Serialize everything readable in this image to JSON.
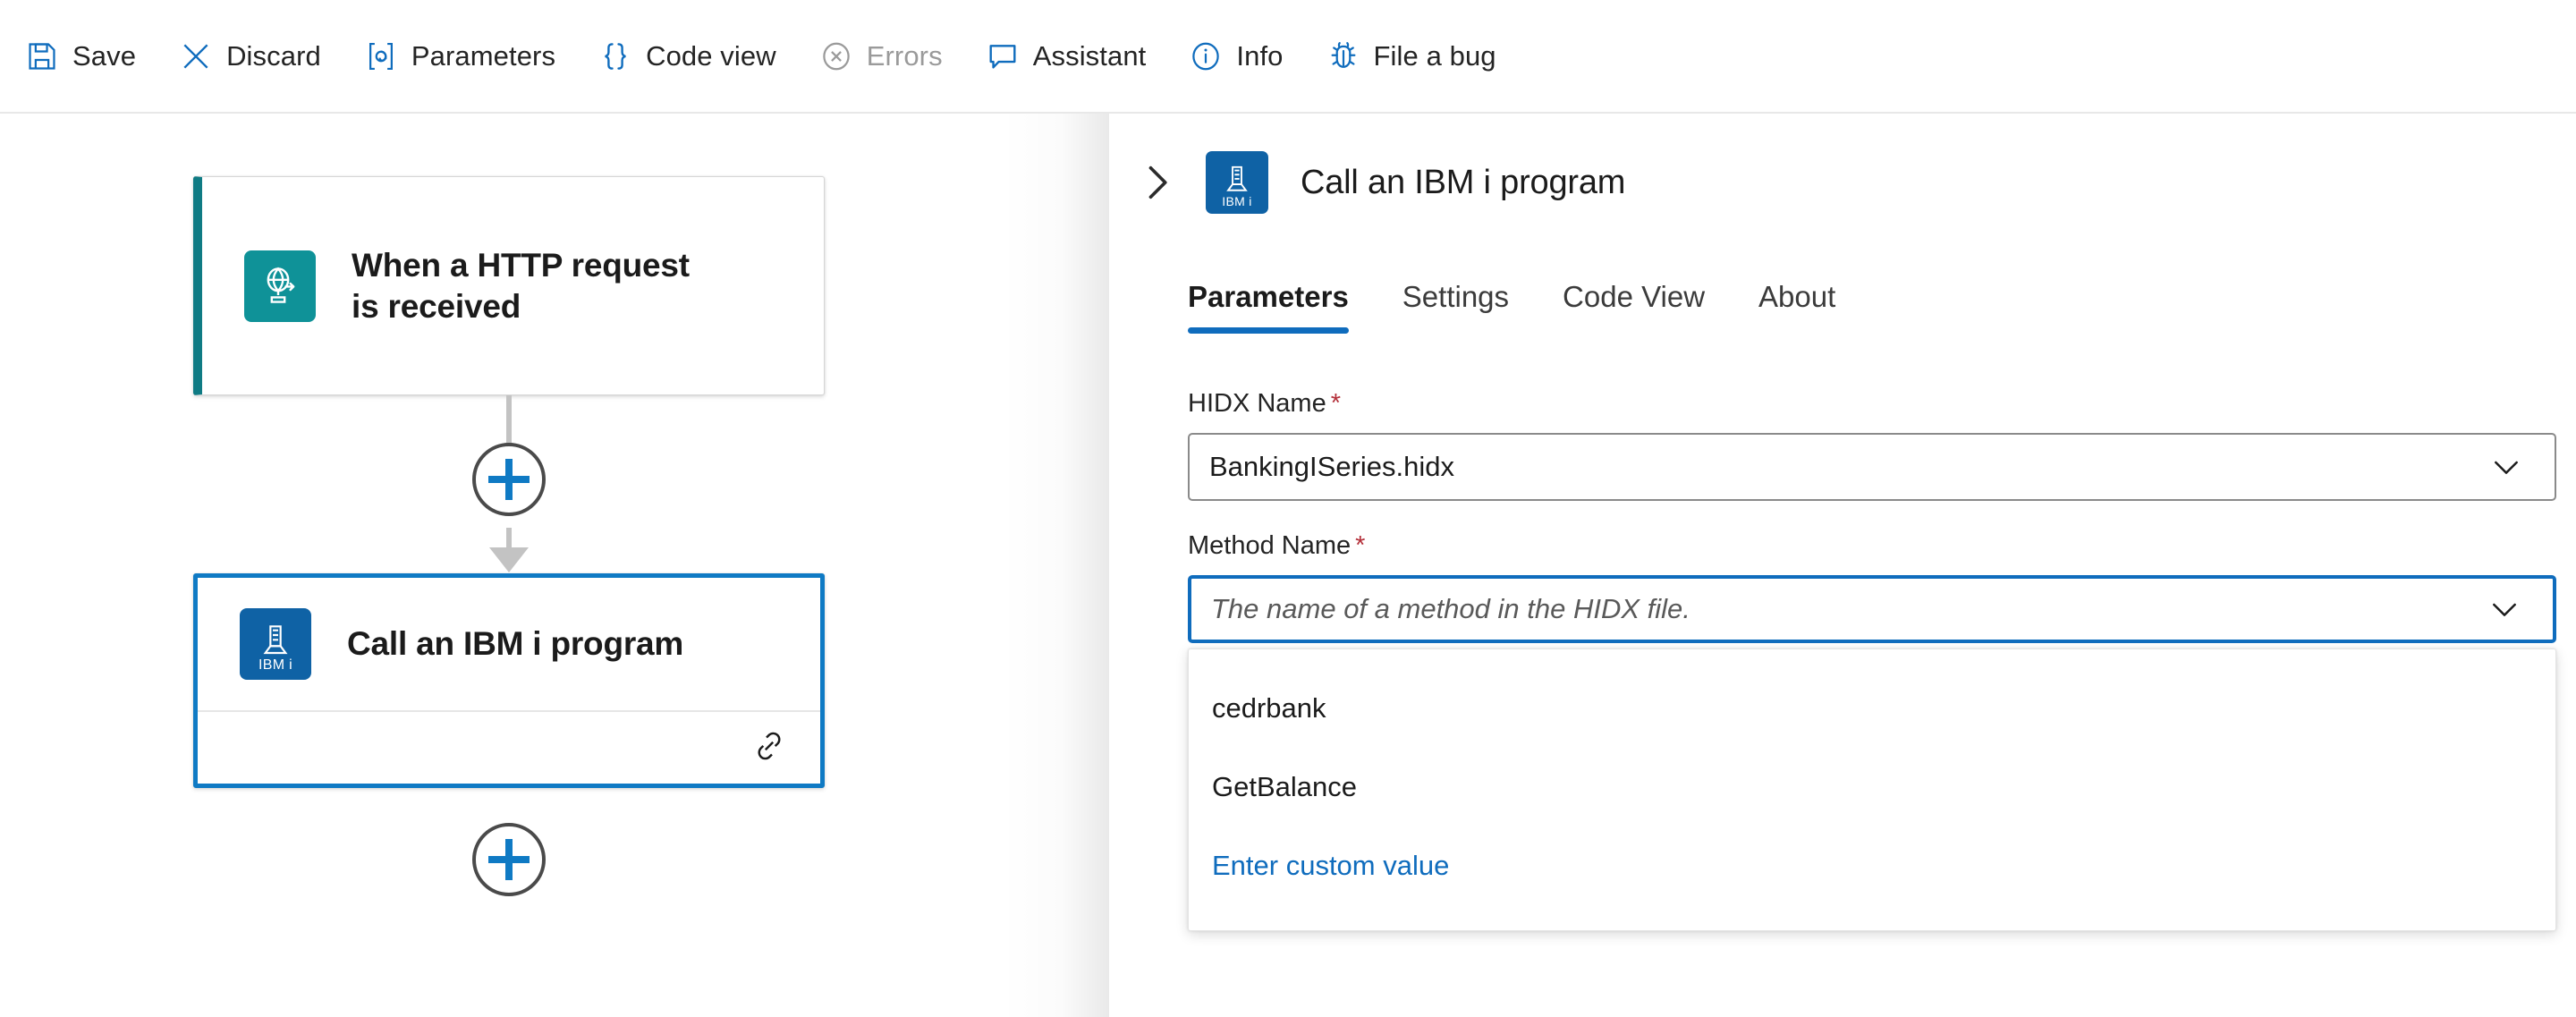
{
  "toolbar": {
    "items": [
      {
        "label": "Save",
        "icon": "save-icon",
        "disabled": false
      },
      {
        "label": "Discard",
        "icon": "discard-icon",
        "disabled": false
      },
      {
        "label": "Parameters",
        "icon": "parameters-icon",
        "disabled": false
      },
      {
        "label": "Code view",
        "icon": "code-view-icon",
        "disabled": false
      },
      {
        "label": "Errors",
        "icon": "errors-icon",
        "disabled": true
      },
      {
        "label": "Assistant",
        "icon": "assistant-icon",
        "disabled": false
      },
      {
        "label": "Info",
        "icon": "info-icon",
        "disabled": false
      },
      {
        "label": "File a bug",
        "icon": "bug-icon",
        "disabled": false
      }
    ]
  },
  "canvas": {
    "trigger_node": {
      "title_line1": "When a HTTP request",
      "title_line2": "is received",
      "icon": "http-request-icon",
      "accent_color": "#0f7b84"
    },
    "action_node": {
      "title": "Call an IBM i program",
      "icon": "ibm-i-icon",
      "icon_label": "IBM i",
      "footer_icon": "link-icon",
      "selected_color": "#0f7ac4"
    },
    "add_buttons": [
      {
        "name": "insert-step-between"
      },
      {
        "name": "insert-step-end"
      }
    ]
  },
  "panel": {
    "title": "Call an IBM i program",
    "icon_label": "IBM i",
    "collapse_icon": "chevron-right-icon",
    "tabs": [
      {
        "label": "Parameters",
        "active": true
      },
      {
        "label": "Settings",
        "active": false
      },
      {
        "label": "Code View",
        "active": false
      },
      {
        "label": "About",
        "active": false
      }
    ],
    "fields": {
      "hidx_name": {
        "label": "HIDX Name",
        "required_marker": "*",
        "value": "BankingISeries.hidx",
        "focused": false
      },
      "method_name": {
        "label": "Method Name",
        "required_marker": "*",
        "value": "",
        "placeholder": "The name of a method in the HIDX file.",
        "focused": true
      }
    },
    "dropdown": {
      "options": [
        {
          "label": "cedrbank",
          "is_link": false
        },
        {
          "label": "GetBalance",
          "is_link": false
        },
        {
          "label": "Enter custom value",
          "is_link": true
        }
      ]
    }
  },
  "colors": {
    "accent_blue": "#0f6cbd",
    "trigger_teal": "#0f9298",
    "ibm_blue": "#0f62a5",
    "required_red": "#b4303a",
    "disabled_gray": "#9a9a9a"
  }
}
